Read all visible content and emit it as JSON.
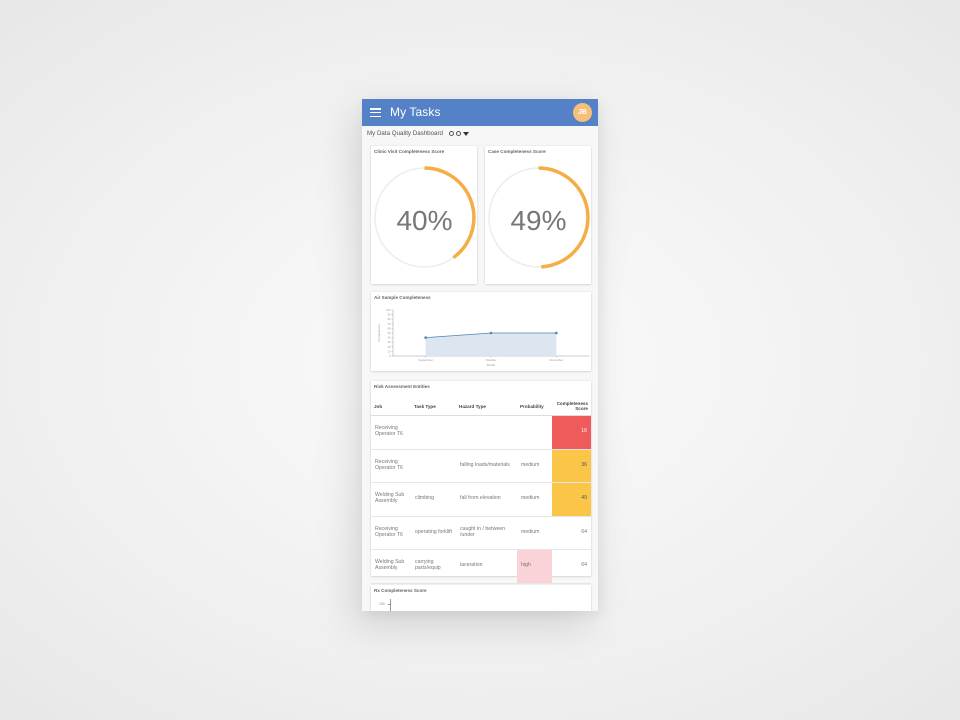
{
  "appbar": {
    "title": "My Tasks",
    "avatar_initials": "JB"
  },
  "dashboard": {
    "title": "My Data Quality Dashboard",
    "icons": [
      "info-icon",
      "minus-circle-icon",
      "filter-icon"
    ]
  },
  "gauges": [
    {
      "title": "Clinic Visit Completeness Score",
      "value": 40,
      "label": "40%"
    },
    {
      "title": "Case Completeness Score",
      "value": 49,
      "label": "49%"
    }
  ],
  "colors": {
    "accent": "#5582c6",
    "gauge": "#f5ad46",
    "track": "#eeeeee",
    "red": "#ef5b5b",
    "amber": "#fbc547",
    "pink": "#f9d3d8",
    "area": "#dbe6f1",
    "line": "#4b86b4"
  },
  "air_sample": {
    "title": "Air Sample Completeness",
    "chart_data": {
      "type": "area",
      "categories": [
        "September",
        "October",
        "November"
      ],
      "values": [
        40,
        50,
        50
      ],
      "ylabel": "Completeness",
      "xlabel": "Month",
      "yticks": [
        "0",
        "10",
        "20",
        "30",
        "40",
        "50",
        "60",
        "70",
        "80",
        "90",
        "100"
      ],
      "ylim": [
        0,
        100
      ]
    }
  },
  "risk": {
    "title": "Risk Assessment Entities",
    "headers": [
      "Job",
      "Task Type",
      "Hazard Type",
      "Probability",
      "Completeness Score"
    ],
    "rows": [
      {
        "job": "Receiving Operator T6",
        "task": "",
        "hazard": "",
        "probability": "",
        "score": "16"
      },
      {
        "job": "Receiving Operator T6",
        "task": "",
        "hazard": "falling loads/materials",
        "probability": "medium",
        "score": "36"
      },
      {
        "job": "Welding Sub Assembly",
        "task": "climbing",
        "hazard": "fall from elevation",
        "probability": "medium",
        "score": "49"
      },
      {
        "job": "Receiving Operator T6",
        "task": "operating forklift",
        "hazard": "caught in / between /under",
        "probability": "medium",
        "score": "64"
      },
      {
        "job": "Welding Sub Assembly",
        "task": "carrying parts/equip",
        "hazard": "laceration",
        "probability": "high",
        "score": "64"
      }
    ]
  },
  "rx": {
    "title": "Rx Completeness Score",
    "first_tick": "100"
  }
}
